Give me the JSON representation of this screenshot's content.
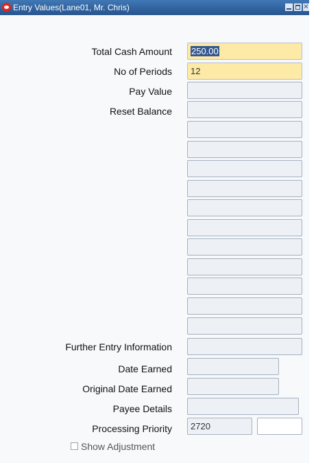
{
  "window": {
    "title": "Entry Values(Lane01, Mr. Chris)"
  },
  "fields": {
    "total_cash_amount": {
      "label": "Total Cash Amount",
      "value": "250.00"
    },
    "no_of_periods": {
      "label": "No of Periods",
      "value": "12"
    },
    "pay_value": {
      "label": "Pay Value",
      "value": ""
    },
    "reset_balance": {
      "label": "Reset Balance",
      "value": ""
    },
    "further_entry_information": {
      "label": "Further Entry Information",
      "value": ""
    },
    "date_earned": {
      "label": "Date Earned",
      "value": ""
    },
    "original_date_earned": {
      "label": "Original Date Earned",
      "value": ""
    },
    "payee_details": {
      "label": "Payee Details",
      "value": ""
    },
    "processing_priority": {
      "label": "Processing Priority",
      "value": "2720"
    }
  },
  "show_adjustment": {
    "label": "Show Adjustment",
    "checked": false
  },
  "colors": {
    "required_field": "#fdeaa6",
    "readonly_field": "#edf1f6",
    "titlebar": "#3f78b5",
    "selection": "#33578f"
  }
}
